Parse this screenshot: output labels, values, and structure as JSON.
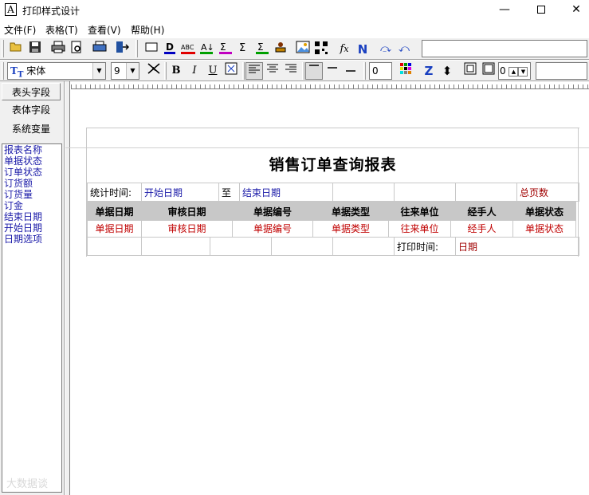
{
  "window": {
    "title": "打印样式设计",
    "app_icon_letter": "A",
    "min": "—",
    "close": "✕"
  },
  "menu": [
    "文件(F)",
    "表格(T)",
    "查看(V)",
    "帮助(H)"
  ],
  "toolbar2": {
    "font": "宋体",
    "size": "9",
    "spin_value": "0",
    "spin2_value": "0"
  },
  "left_panel": {
    "tabs": [
      "表头字段",
      "表体字段",
      "系统变量"
    ],
    "fields": [
      "报表名称",
      "单据状态",
      "订单状态",
      "订货额",
      "订货量",
      "订金",
      "结束日期",
      "开始日期",
      "日期选项"
    ]
  },
  "report": {
    "title": "销售订单查询报表",
    "stat_label": "统计时间:",
    "start_date": "开始日期",
    "to": "至",
    "end_date": "结束日期",
    "total_pages": "总页数",
    "columns": [
      "单据日期",
      "审核日期",
      "单据编号",
      "单据类型",
      "往来单位",
      "经手人",
      "单据状态"
    ],
    "data_row": [
      "单据日期",
      "审核日期",
      "单据编号",
      "单据类型",
      "往来单位",
      "经手人",
      "单据状态"
    ],
    "print_time_label": "打印时间:",
    "print_date": "日期"
  },
  "watermark": "大数据谈"
}
